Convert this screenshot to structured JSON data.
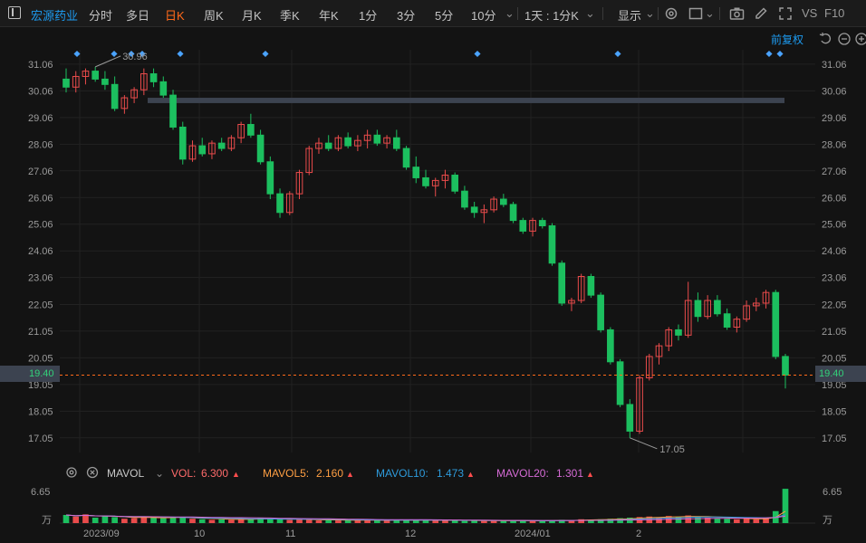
{
  "toolbar": {
    "stock_name": "宏源药业",
    "periods": [
      "分时",
      "多日",
      "日K",
      "周K",
      "月K",
      "季K",
      "年K",
      "1分",
      "3分",
      "5分",
      "10分"
    ],
    "active_period": "日K",
    "interval_select": "1天 : 1分K",
    "display_label": "显示",
    "vs_label": "VS",
    "f10_label": "F10"
  },
  "header": {
    "adjust_label": "前复权"
  },
  "price_axis": {
    "ticks": [
      "31.06",
      "30.06",
      "29.06",
      "28.06",
      "27.06",
      "26.06",
      "25.06",
      "24.06",
      "23.06",
      "22.05",
      "21.05",
      "20.05",
      "19.05",
      "18.05",
      "17.05"
    ],
    "current_price": "19.40",
    "high_marker": "30.96",
    "low_marker": "17.05"
  },
  "volume_legend": {
    "indicator_label": "MAVOL",
    "vol_label": "VOL:",
    "vol_value": "6.300",
    "mavol5_label": "MAVOL5:",
    "mavol5_value": "2.160",
    "mavol10_label": "MAVOL10:",
    "mavol10_value": "1.473",
    "mavol20_label": "MAVOL20:",
    "mavol20_value": "1.301",
    "colors": {
      "vol": "#ff6b6b",
      "mavol5": "#ff9f43",
      "mavol10": "#2e9bdc",
      "mavol20": "#d66bd6"
    }
  },
  "volume_axis": {
    "max_label": "6.65",
    "unit_label": "万"
  },
  "x_axis": {
    "labels": [
      "2023/09",
      "10",
      "11",
      "12",
      "2024/01",
      "2"
    ]
  },
  "colors": {
    "up": "#e94b4b",
    "down": "#1cbf5f",
    "accent": "#ff6a1a",
    "link": "#1d9bf0"
  },
  "chart_data": {
    "type": "candlestick",
    "series": [
      {
        "name": "",
        "ohlc": [
          [
            30.5,
            30.9,
            30.0,
            30.2
          ],
          [
            30.2,
            30.8,
            30.0,
            30.6
          ],
          [
            30.6,
            30.9,
            30.3,
            30.8
          ],
          [
            30.8,
            30.96,
            30.4,
            30.5
          ],
          [
            30.5,
            30.8,
            30.1,
            30.3
          ],
          [
            30.3,
            30.6,
            29.3,
            29.4
          ],
          [
            29.4,
            29.9,
            29.2,
            29.8
          ],
          [
            29.8,
            30.2,
            29.6,
            30.1
          ],
          [
            30.1,
            30.9,
            29.9,
            30.7
          ],
          [
            30.7,
            30.9,
            30.2,
            30.4
          ],
          [
            30.4,
            30.6,
            29.8,
            29.9
          ],
          [
            29.9,
            30.1,
            28.6,
            28.7
          ],
          [
            28.7,
            28.9,
            27.3,
            27.5
          ],
          [
            27.5,
            28.2,
            27.4,
            28.0
          ],
          [
            28.0,
            28.3,
            27.6,
            27.7
          ],
          [
            27.7,
            28.2,
            27.5,
            28.1
          ],
          [
            28.1,
            28.3,
            27.8,
            27.9
          ],
          [
            27.9,
            28.4,
            27.8,
            28.3
          ],
          [
            28.3,
            28.9,
            28.1,
            28.8
          ],
          [
            28.8,
            29.2,
            28.3,
            28.4
          ],
          [
            28.4,
            28.6,
            27.3,
            27.4
          ],
          [
            27.4,
            27.6,
            26.0,
            26.2
          ],
          [
            26.2,
            26.4,
            25.3,
            25.5
          ],
          [
            25.5,
            26.3,
            25.4,
            26.2
          ],
          [
            26.2,
            27.1,
            26.0,
            27.0
          ],
          [
            27.0,
            28.0,
            26.9,
            27.9
          ],
          [
            27.9,
            28.3,
            27.7,
            28.1
          ],
          [
            28.1,
            28.4,
            27.8,
            27.9
          ],
          [
            27.9,
            28.4,
            27.8,
            28.3
          ],
          [
            28.3,
            28.5,
            27.9,
            28.0
          ],
          [
            28.0,
            28.4,
            27.8,
            28.2
          ],
          [
            28.2,
            28.6,
            27.9,
            28.4
          ],
          [
            28.4,
            28.6,
            28.0,
            28.1
          ],
          [
            28.1,
            28.4,
            27.9,
            28.3
          ],
          [
            28.3,
            28.6,
            27.8,
            27.9
          ],
          [
            27.9,
            28.0,
            27.1,
            27.2
          ],
          [
            27.2,
            27.6,
            26.6,
            26.8
          ],
          [
            26.8,
            27.1,
            26.4,
            26.5
          ],
          [
            26.5,
            26.8,
            26.1,
            26.7
          ],
          [
            26.7,
            27.1,
            26.4,
            26.9
          ],
          [
            26.9,
            27.0,
            26.2,
            26.3
          ],
          [
            26.3,
            26.5,
            25.6,
            25.7
          ],
          [
            25.7,
            25.9,
            25.3,
            25.5
          ],
          [
            25.5,
            25.8,
            25.1,
            25.6
          ],
          [
            25.6,
            26.1,
            25.5,
            26.0
          ],
          [
            26.0,
            26.2,
            25.7,
            25.8
          ],
          [
            25.8,
            25.9,
            25.1,
            25.2
          ],
          [
            25.2,
            25.3,
            24.7,
            24.8
          ],
          [
            24.8,
            25.3,
            24.6,
            25.2
          ],
          [
            25.2,
            25.3,
            24.9,
            25.0
          ],
          [
            25.0,
            25.1,
            23.5,
            23.6
          ],
          [
            23.6,
            23.7,
            22.0,
            22.1
          ],
          [
            22.1,
            22.3,
            21.8,
            22.2
          ],
          [
            22.2,
            23.2,
            22.1,
            23.1
          ],
          [
            23.1,
            23.2,
            22.3,
            22.4
          ],
          [
            22.4,
            22.5,
            21.0,
            21.1
          ],
          [
            21.1,
            21.2,
            19.8,
            19.9
          ],
          [
            19.9,
            20.0,
            18.2,
            18.3
          ],
          [
            18.3,
            18.5,
            17.05,
            17.3
          ],
          [
            17.3,
            19.4,
            17.2,
            19.3
          ],
          [
            19.3,
            20.2,
            19.2,
            20.1
          ],
          [
            20.1,
            20.6,
            19.8,
            20.5
          ],
          [
            20.5,
            21.2,
            20.3,
            21.1
          ],
          [
            21.1,
            21.3,
            20.7,
            20.9
          ],
          [
            20.9,
            22.9,
            20.8,
            22.2
          ],
          [
            22.2,
            22.5,
            21.4,
            21.6
          ],
          [
            21.6,
            22.4,
            21.5,
            22.2
          ],
          [
            22.2,
            22.4,
            21.6,
            21.7
          ],
          [
            21.7,
            21.9,
            21.1,
            21.2
          ],
          [
            21.2,
            21.6,
            21.0,
            21.5
          ],
          [
            21.5,
            22.2,
            21.4,
            22.0
          ],
          [
            22.0,
            22.3,
            21.8,
            22.1
          ],
          [
            22.1,
            22.6,
            21.9,
            22.5
          ],
          [
            22.5,
            22.6,
            20.0,
            20.1
          ],
          [
            20.1,
            20.2,
            18.9,
            19.4
          ]
        ]
      }
    ],
    "volume": [
      1.5,
      1.2,
      1.6,
      1.0,
      1.3,
      1.1,
      0.8,
      0.9,
      1.2,
      1.1,
      0.9,
      1.0,
      1.1,
      0.8,
      0.7,
      0.6,
      0.7,
      0.6,
      0.8,
      0.7,
      0.9,
      0.8,
      0.7,
      0.6,
      0.7,
      0.6,
      0.5,
      0.5,
      0.6,
      0.5,
      0.5,
      0.6,
      0.5,
      0.5,
      0.6,
      0.5,
      0.5,
      0.6,
      0.5,
      0.5,
      0.5,
      0.4,
      0.5,
      0.4,
      0.5,
      0.4,
      0.4,
      0.5,
      0.4,
      0.4,
      0.5,
      0.6,
      0.5,
      0.7,
      0.6,
      0.7,
      0.8,
      0.9,
      1.0,
      1.1,
      1.2,
      1.0,
      1.3,
      1.1,
      1.4,
      1.2,
      1.0,
      0.9,
      0.8,
      0.7,
      0.8,
      0.7,
      0.9,
      2.2,
      6.3
    ],
    "ylim": [
      16.5,
      31.6
    ],
    "high_label": "30.96",
    "low_label": "17.05",
    "current_line": 19.4,
    "gap_band": [
      29.6,
      29.8
    ]
  }
}
